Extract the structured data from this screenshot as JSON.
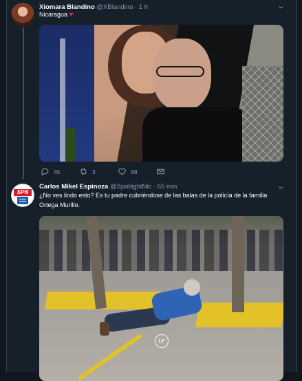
{
  "tweets": [
    {
      "name": "Xiomara Blandino",
      "handle": "@XBlandino",
      "separator": "·",
      "time": "1 h",
      "text": "Nicaragua",
      "emoji": "♥",
      "stats": {
        "replies": "45",
        "retweets": "3",
        "likes": "68"
      }
    },
    {
      "name": "Carlos Mikel Espinoza",
      "handle": "@SpotlightNic",
      "separator": "·",
      "time": "55 min",
      "text": "¿No ves lindo esto? Es tu padre cubriéndose de las balas de la policía de la familia Ortega Murillo.",
      "avatar_text": "SPN",
      "watermark": "LP"
    }
  ],
  "icons": {
    "chevron": "chevron-down-icon",
    "reply": "reply-icon",
    "retweet": "retweet-icon",
    "like": "heart-icon",
    "dm": "envelope-icon"
  },
  "colors": {
    "background": "#15202b",
    "text_secondary": "#8899a6",
    "heart": "#e0245e",
    "thread_line": "#3d5466"
  }
}
